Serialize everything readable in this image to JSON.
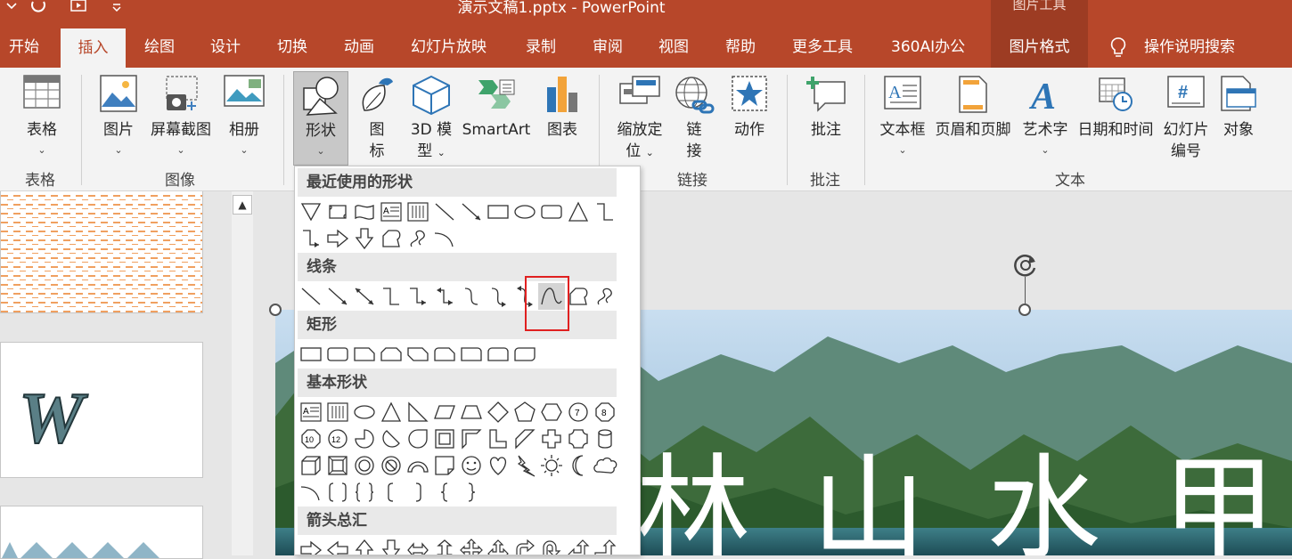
{
  "title_bar": {
    "document_title": "演示文稿1.pptx  -  PowerPoint",
    "context_tool_group": "图片工具"
  },
  "tabs": [
    {
      "label": "开始"
    },
    {
      "label": "插入"
    },
    {
      "label": "绘图"
    },
    {
      "label": "设计"
    },
    {
      "label": "切换"
    },
    {
      "label": "动画"
    },
    {
      "label": "幻灯片放映"
    },
    {
      "label": "录制"
    },
    {
      "label": "审阅"
    },
    {
      "label": "视图"
    },
    {
      "label": "帮助"
    },
    {
      "label": "更多工具"
    },
    {
      "label": "360AI办公"
    },
    {
      "label": "图片格式"
    }
  ],
  "tell_me": "操作说明搜索",
  "ribbon": {
    "buttons": {
      "table": "表格",
      "pictures": "图片",
      "screenshot": "屏幕截图",
      "album": "相册",
      "shapes": "形状",
      "icons_l1": "图",
      "icons_l2": "标",
      "model3d_l1": "3D 模",
      "model3d_l2": "型",
      "smartart": "SmartArt",
      "chart": "图表",
      "zoom_l1": "缩放定",
      "zoom_l2": "位",
      "link_l1": "链",
      "link_l2": "接",
      "action": "动作",
      "comment": "批注",
      "textbox": "文本框",
      "header_footer": "页眉和页脚",
      "wordart": "艺术字",
      "datetime": "日期和时间",
      "slide_num_l1": "幻灯片",
      "slide_num_l2": "编号",
      "object": "对象"
    },
    "groups": {
      "tables": "表格",
      "images": "图像",
      "links": "链接",
      "comments": "批注",
      "text": "文本"
    }
  },
  "gallery": {
    "sections": {
      "recent": "最近使用的形状",
      "lines": "线条",
      "rectangles": "矩形",
      "basic": "基本形状",
      "arrows": "箭头总汇"
    },
    "highlighted_shape": "curve"
  },
  "slide": {
    "text": "林 山 水 甲"
  },
  "colors": {
    "accent": "#b7472a",
    "accent_dark": "#9d3c23",
    "highlight_box": "#e02020"
  }
}
